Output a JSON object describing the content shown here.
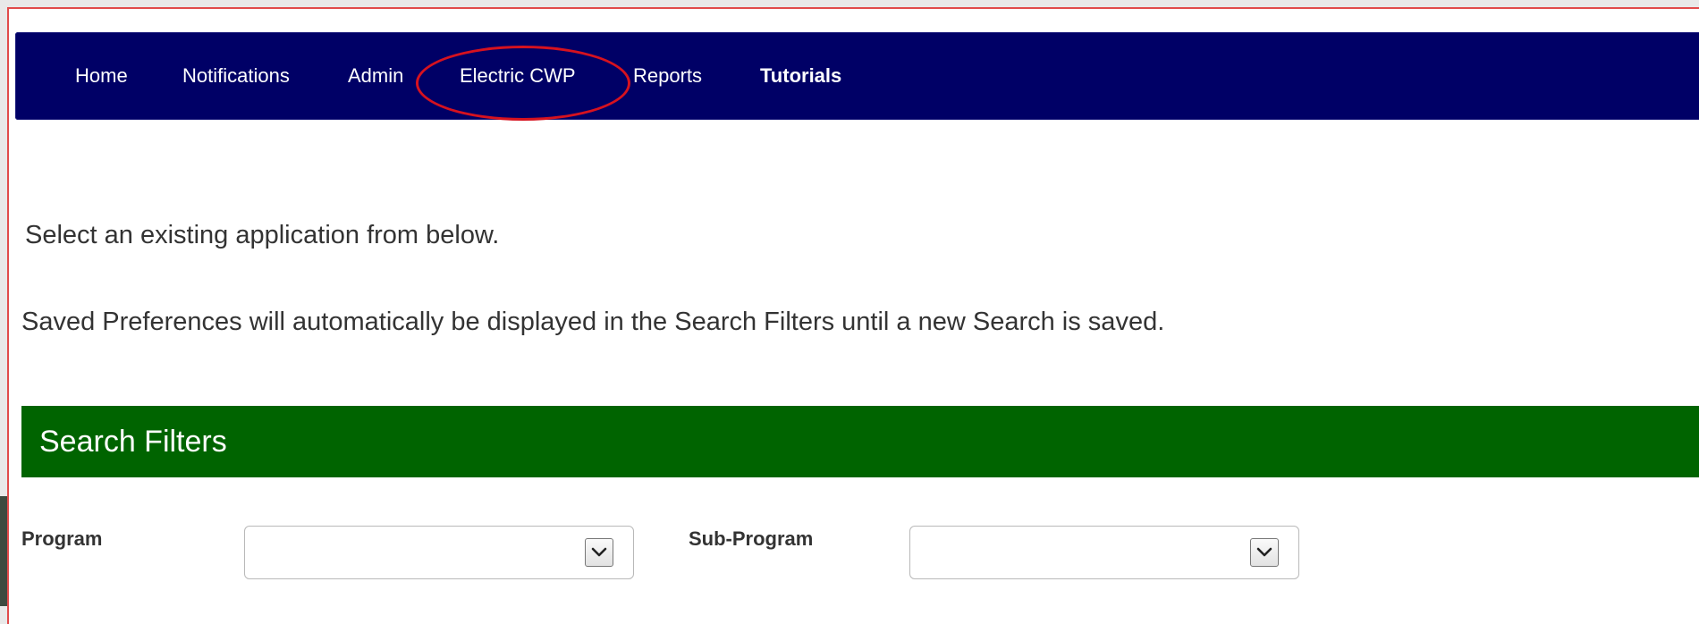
{
  "nav": {
    "items": [
      {
        "label": "Home"
      },
      {
        "label": "Notifications"
      },
      {
        "label": "Admin"
      },
      {
        "label": "Electric CWP"
      },
      {
        "label": "Reports"
      },
      {
        "label": "Tutorials"
      }
    ],
    "highlighted_item": "Electric CWP",
    "highlight_color": "#d6121f"
  },
  "main": {
    "intro_text": "Select an existing application from below.",
    "preferences_note": "Saved Preferences will automatically be displayed in the Search Filters until a new Search is saved."
  },
  "search_filters": {
    "title": "Search Filters",
    "program": {
      "label": "Program",
      "value": ""
    },
    "sub_program": {
      "label": "Sub-Program",
      "value": ""
    }
  },
  "colors": {
    "nav_background": "#000066",
    "filters_background": "#006400",
    "frame_border": "#e14b4b"
  }
}
